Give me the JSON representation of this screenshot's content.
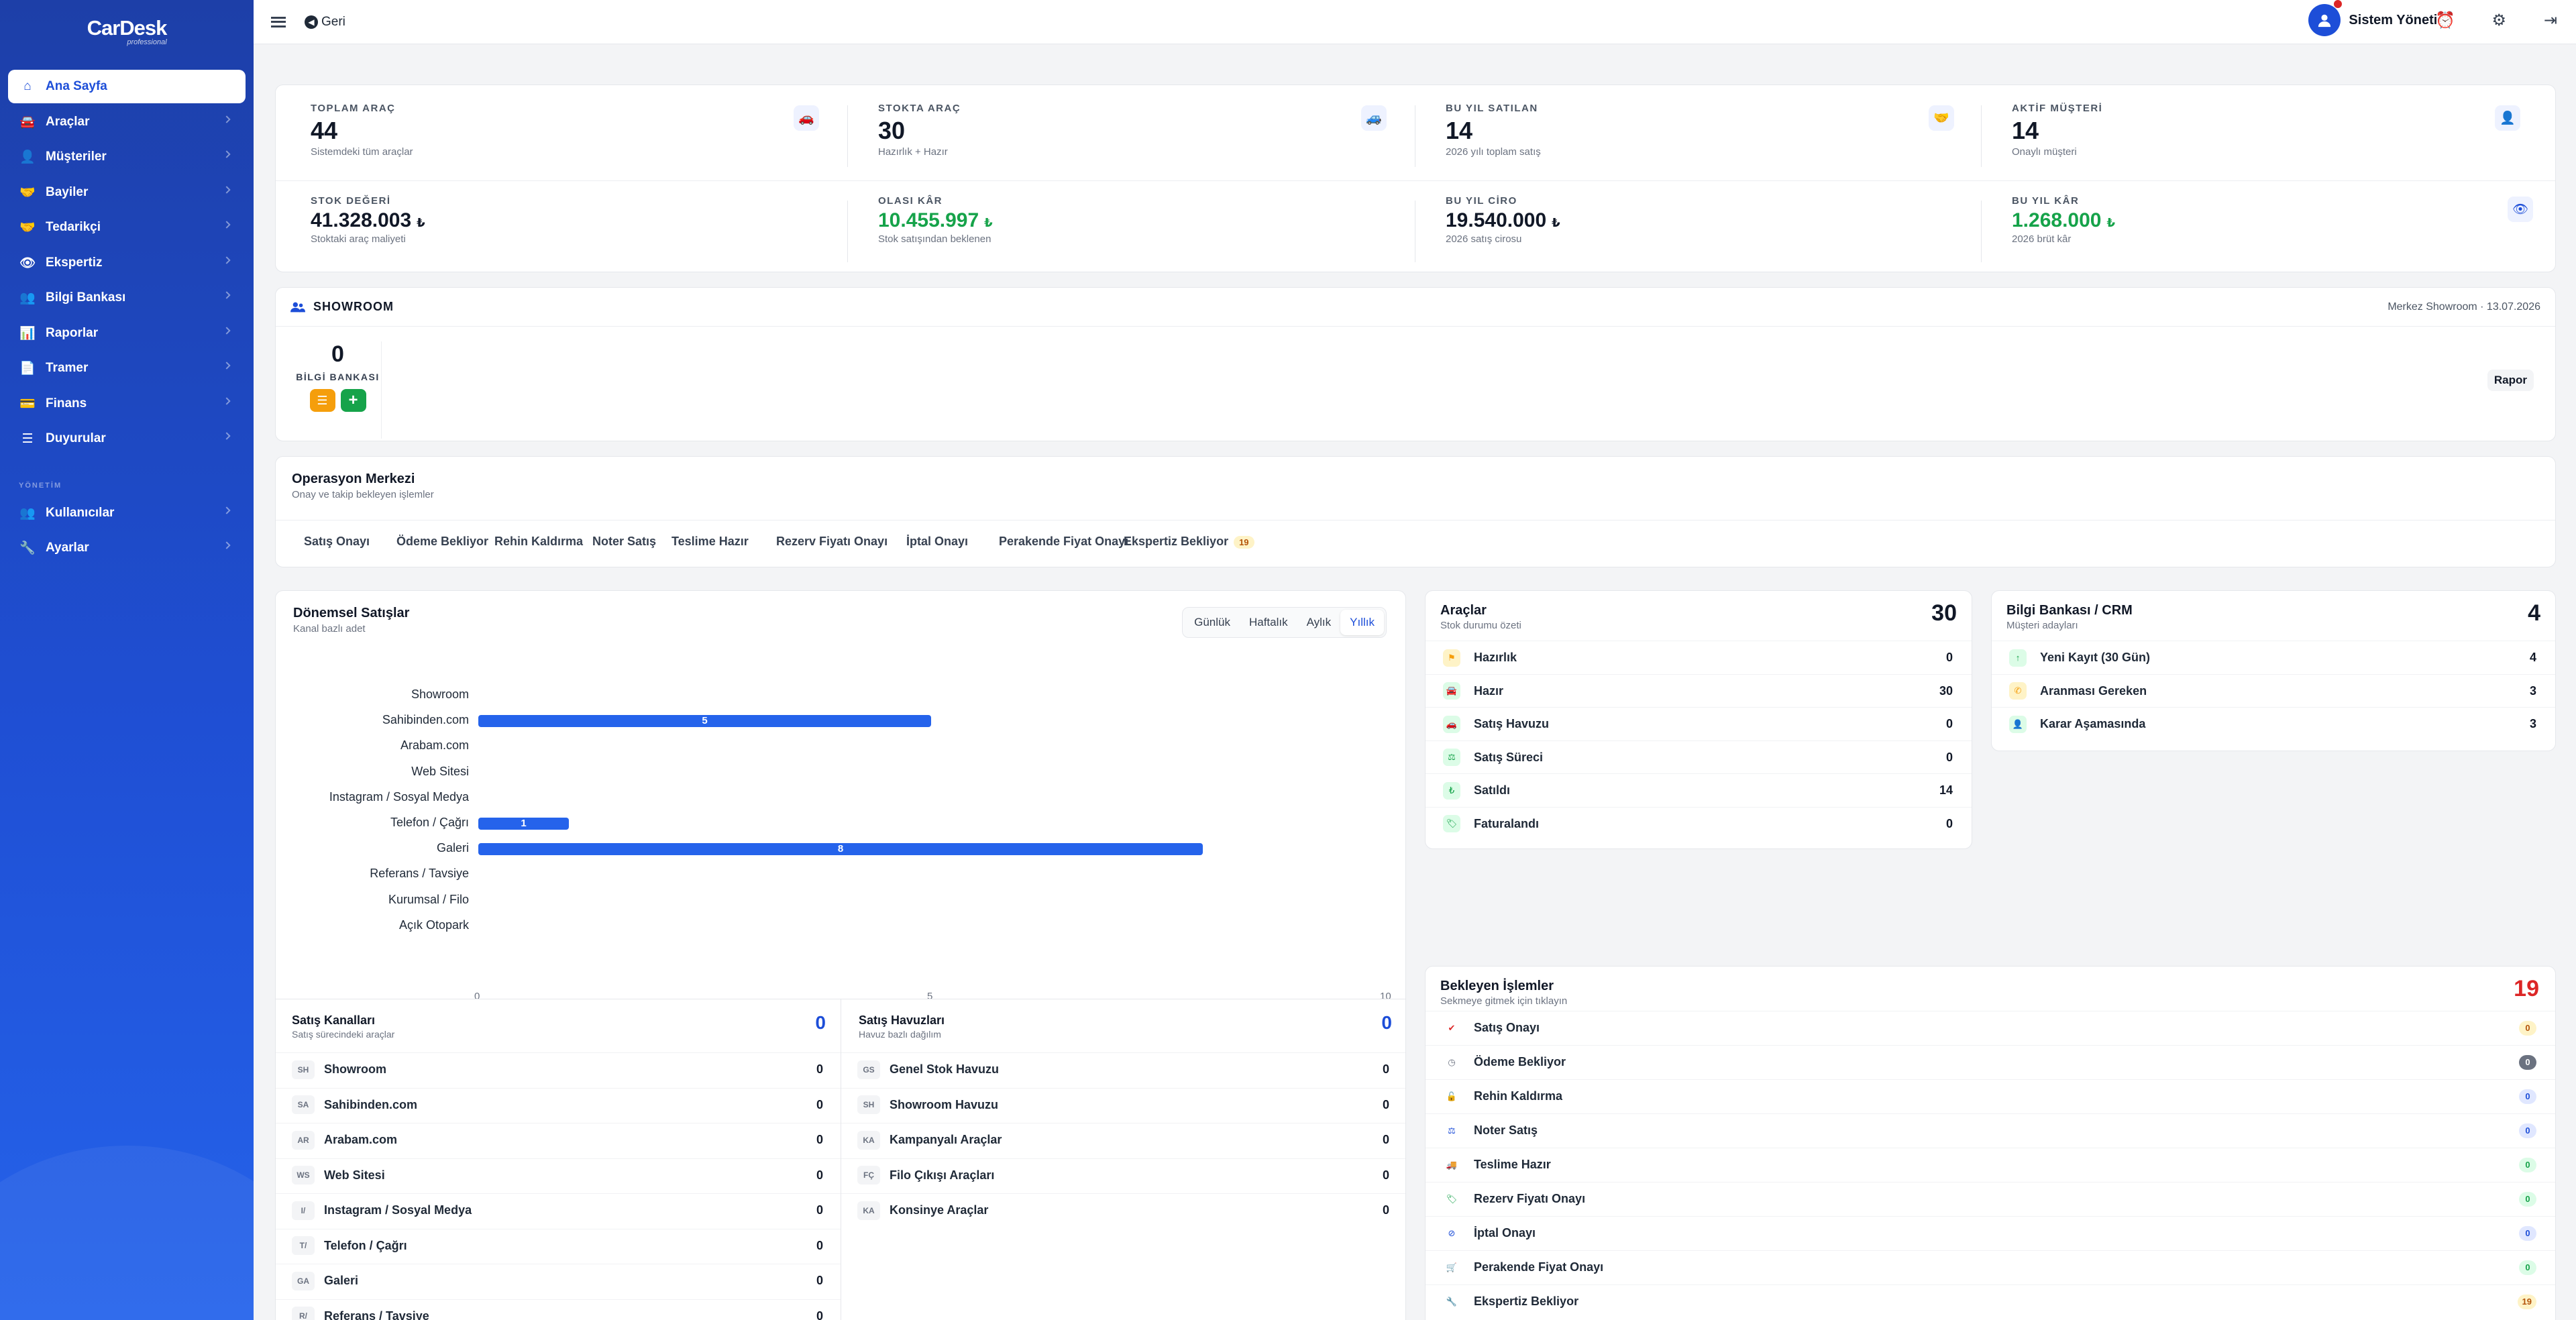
{
  "brand": {
    "name": "CarDesk",
    "tagline": "professional"
  },
  "sidebar": {
    "items": [
      {
        "label": "Ana Sayfa",
        "icon": "home-icon"
      },
      {
        "label": "Araçlar",
        "icon": "car-icon"
      },
      {
        "label": "Müşteriler",
        "icon": "user-icon"
      },
      {
        "label": "Bayiler",
        "icon": "handshake-icon"
      },
      {
        "label": "Tedarikçi",
        "icon": "handshake-icon"
      },
      {
        "label": "Ekspertiz",
        "icon": "eye-icon"
      },
      {
        "label": "Bilgi Bankası",
        "icon": "users-icon"
      },
      {
        "label": "Raporlar",
        "icon": "chart-icon"
      },
      {
        "label": "Tramer",
        "icon": "document-icon"
      },
      {
        "label": "Finans",
        "icon": "wallet-icon"
      },
      {
        "label": "Duyurular",
        "icon": "list-icon"
      }
    ],
    "section": "YÖNETİM",
    "admin_items": [
      {
        "label": "Kullanıcılar",
        "icon": "users-icon"
      },
      {
        "label": "Ayarlar",
        "icon": "wrench-icon"
      }
    ]
  },
  "topbar": {
    "back_label": "Geri",
    "user_name": "Sistem Yönetici"
  },
  "stats_top": [
    {
      "label": "TOPLAM ARAÇ",
      "value": "44",
      "sub": "Sistemdeki tüm araçlar",
      "icon": "cars-icon"
    },
    {
      "label": "STOKTA ARAÇ",
      "value": "30",
      "sub": "Hazırlık + Hazır",
      "icon": "car-front-icon"
    },
    {
      "label": "BU YIL SATILAN",
      "value": "14",
      "sub": "2026 yılı toplam satış",
      "icon": "handshake-icon"
    },
    {
      "label": "AKTİF MÜŞTERİ",
      "value": "14",
      "sub": "Onaylı müşteri",
      "icon": "user-icon"
    }
  ],
  "stats_bottom": [
    {
      "label": "STOK DEĞERİ",
      "value": "41.328.003",
      "currency": "₺",
      "sub": "Stoktaki araç maliyeti"
    },
    {
      "label": "OLASI KÂR",
      "value": "10.455.997",
      "currency": "₺",
      "sub": "Stok satışından beklenen"
    },
    {
      "label": "BU YIL CİRO",
      "value": "19.540.000",
      "currency": "₺",
      "sub": "2026 satış cirosu"
    },
    {
      "label": "BU YIL KÂR",
      "value": "1.268.000",
      "currency": "₺",
      "sub": "2026 brüt kâr"
    }
  ],
  "showroom": {
    "title": "SHOWROOM",
    "meta": "Merkez Showroom · 13.07.2026",
    "count": "0",
    "label": "BİLGİ BANKASI",
    "report": "Rapor"
  },
  "operations": {
    "title": "Operasyon Merkezi",
    "subtitle": "Onay ve takip bekleyen işlemler",
    "tabs": [
      "Satış Onayı",
      "Ödeme Bekliyor",
      "Rehin Kaldırma",
      "Noter Satış",
      "Teslime Hazır",
      "Rezerv Fiyatı Onayı",
      "İptal Onayı",
      "Perakende Fiyat Onayı",
      "Ekspertiz Bekliyor"
    ],
    "tab_badge": "19"
  },
  "periodic": {
    "title": "Dönemsel Satışlar",
    "subtitle": "Kanal bazlı adet",
    "periods": [
      "Günlük",
      "Haftalık",
      "Aylık",
      "Yıllık"
    ],
    "active_period": "Yıllık"
  },
  "chart_data": {
    "type": "bar",
    "orientation": "horizontal",
    "categories": [
      "Showroom",
      "Sahibinden.com",
      "Arabam.com",
      "Web Sitesi",
      "Instagram / Sosyal Medya",
      "Telefon / Çağrı",
      "Galeri",
      "Referans / Tavsiye",
      "Kurumsal / Filo",
      "Açık Otopark"
    ],
    "values": [
      0,
      5,
      0,
      0,
      0,
      1,
      8,
      0,
      0,
      0
    ],
    "xlim": [
      0,
      10
    ],
    "xticks": [
      "0",
      "5",
      "10"
    ]
  },
  "vehicles": {
    "title": "Araçlar",
    "subtitle": "Stok durumu özeti",
    "total": "30",
    "rows": [
      {
        "label": "Hazırlık",
        "value": "0",
        "icon": "flag-icon",
        "color": "#f59e0b",
        "bg": "#fef3c7"
      },
      {
        "label": "Hazır",
        "value": "30",
        "icon": "car-icon",
        "color": "#16a34a",
        "bg": "#dcfce7"
      },
      {
        "label": "Satış Havuzu",
        "value": "0",
        "icon": "cars-icon",
        "color": "#16a34a",
        "bg": "#dcfce7"
      },
      {
        "label": "Satış Süreci",
        "value": "0",
        "icon": "gavel-icon",
        "color": "#16a34a",
        "bg": "#dcfce7"
      },
      {
        "label": "Satıldı",
        "value": "14",
        "icon": "lira-icon",
        "color": "#16a34a",
        "bg": "#dcfce7"
      },
      {
        "label": "Faturalandı",
        "value": "0",
        "icon": "tag-icon",
        "color": "#16a34a",
        "bg": "#dcfce7"
      }
    ]
  },
  "crm": {
    "title": "Bilgi Bankası / CRM",
    "subtitle": "Müşteri adayları",
    "total": "4",
    "rows": [
      {
        "label": "Yeni Kayıt (30 Gün)",
        "value": "4",
        "icon": "arrow-up-icon",
        "color": "#16a34a",
        "bg": "#dcfce7"
      },
      {
        "label": "Aranması Gereken",
        "value": "3",
        "icon": "phone-icon",
        "color": "#f59e0b",
        "bg": "#fef3c7"
      },
      {
        "label": "Karar Aşamasında",
        "value": "3",
        "icon": "user-icon",
        "color": "#16a34a",
        "bg": "#dcfce7"
      }
    ]
  },
  "channels": {
    "title": "Satış Kanalları",
    "subtitle": "Satış sürecindeki araçlar",
    "total": "0",
    "rows": [
      {
        "abbr": "SH",
        "label": "Showroom",
        "value": "0"
      },
      {
        "abbr": "SA",
        "label": "Sahibinden.com",
        "value": "0"
      },
      {
        "abbr": "AR",
        "label": "Arabam.com",
        "value": "0"
      },
      {
        "abbr": "WS",
        "label": "Web Sitesi",
        "value": "0"
      },
      {
        "abbr": "I/",
        "label": "Instagram / Sosyal Medya",
        "value": "0"
      },
      {
        "abbr": "T/",
        "label": "Telefon / Çağrı",
        "value": "0"
      },
      {
        "abbr": "GA",
        "label": "Galeri",
        "value": "0"
      },
      {
        "abbr": "R/",
        "label": "Referans / Tavsiye",
        "value": "0"
      }
    ]
  },
  "pools": {
    "title": "Satış Havuzları",
    "subtitle": "Havuz bazlı dağılım",
    "total": "0",
    "rows": [
      {
        "abbr": "GS",
        "label": "Genel Stok Havuzu",
        "value": "0"
      },
      {
        "abbr": "SH",
        "label": "Showroom Havuzu",
        "value": "0"
      },
      {
        "abbr": "KA",
        "label": "Kampanyalı Araçlar",
        "value": "0"
      },
      {
        "abbr": "FÇ",
        "label": "Filo Çıkışı Araçları",
        "value": "0"
      },
      {
        "abbr": "KA",
        "label": "Konsinye Araçlar",
        "value": "0"
      }
    ]
  },
  "pending": {
    "title": "Bekleyen İşlemler",
    "subtitle": "Sekmeye gitmek için tıklayın",
    "total": "19",
    "rows": [
      {
        "label": "Satış Onayı",
        "value": "0",
        "icon": "check-circle-icon",
        "color": "#dc2626",
        "chip_bg": "#fef3c7",
        "chip_fg": "#b45309"
      },
      {
        "label": "Ödeme Bekliyor",
        "value": "0",
        "icon": "clock-icon",
        "color": "#6b7280",
        "chip_bg": "#6b7280",
        "chip_fg": "#ffffff"
      },
      {
        "label": "Rehin Kaldırma",
        "value": "0",
        "icon": "unlock-icon",
        "color": "#1d4ed8",
        "chip_bg": "#e0e7ff",
        "chip_fg": "#1d4ed8"
      },
      {
        "label": "Noter Satış",
        "value": "0",
        "icon": "gavel-icon",
        "color": "#1d4ed8",
        "chip_bg": "#e0e7ff",
        "chip_fg": "#1d4ed8"
      },
      {
        "label": "Teslime Hazır",
        "value": "0",
        "icon": "truck-icon",
        "color": "#16a34a",
        "chip_bg": "#dcfce7",
        "chip_fg": "#16a34a"
      },
      {
        "label": "Rezerv Fiyatı Onayı",
        "value": "0",
        "icon": "tag-icon",
        "color": "#16a34a",
        "chip_bg": "#dcfce7",
        "chip_fg": "#16a34a"
      },
      {
        "label": "İptal Onayı",
        "value": "0",
        "icon": "ban-icon",
        "color": "#1d4ed8",
        "chip_bg": "#e0e7ff",
        "chip_fg": "#1d4ed8"
      },
      {
        "label": "Perakende Fiyat Onayı",
        "value": "0",
        "icon": "cart-icon",
        "color": "#16a34a",
        "chip_bg": "#dcfce7",
        "chip_fg": "#16a34a"
      },
      {
        "label": "Ekspertiz Bekliyor",
        "value": "19",
        "icon": "wrench-icon",
        "color": "#f59e0b",
        "chip_bg": "#fef3c7",
        "chip_fg": "#b45309"
      }
    ]
  }
}
